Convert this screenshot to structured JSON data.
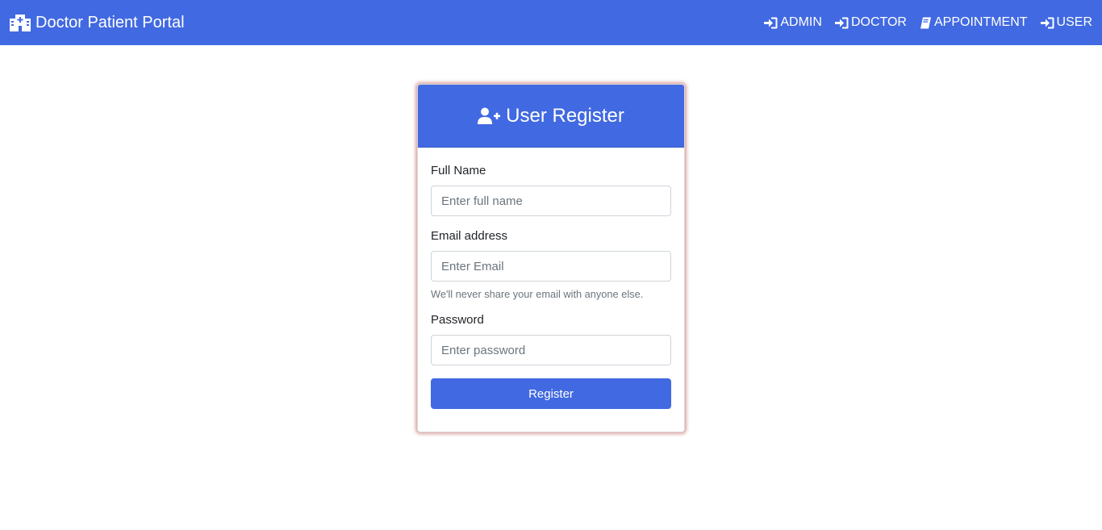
{
  "navbar": {
    "brand": "Doctor Patient Portal",
    "brand_icon": "hospital-icon",
    "links": [
      {
        "label": "ADMIN",
        "icon": "sign-in-icon"
      },
      {
        "label": "DOCTOR",
        "icon": "sign-in-icon"
      },
      {
        "label": "APPOINTMENT",
        "icon": "book-icon"
      },
      {
        "label": "USER",
        "icon": "sign-in-icon"
      }
    ],
    "background_color": "#4169e1"
  },
  "card": {
    "title": "User Register",
    "title_icon": "user-plus-icon",
    "fields": {
      "full_name": {
        "label": "Full Name",
        "placeholder": "Enter full name",
        "value": ""
      },
      "email": {
        "label": "Email address",
        "placeholder": "Enter Email",
        "value": "",
        "help": "We'll never share your email with anyone else."
      },
      "password": {
        "label": "Password",
        "placeholder": "Enter password",
        "value": ""
      }
    },
    "submit_label": "Register"
  },
  "colors": {
    "accent": "#4169e1",
    "card_glow": "#be5050"
  }
}
